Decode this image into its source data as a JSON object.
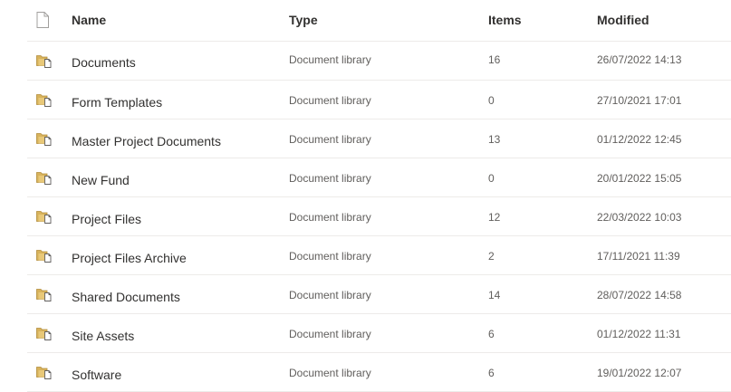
{
  "header": {
    "name": "Name",
    "type": "Type",
    "items": "Items",
    "modified": "Modified"
  },
  "rows": [
    {
      "name": "Documents",
      "type": "Document library",
      "items": "16",
      "modified": "26/07/2022 14:13"
    },
    {
      "name": "Form Templates",
      "type": "Document library",
      "items": "0",
      "modified": "27/10/2021 17:01"
    },
    {
      "name": "Master Project Documents",
      "type": "Document library",
      "items": "13",
      "modified": "01/12/2022 12:45"
    },
    {
      "name": "New Fund",
      "type": "Document library",
      "items": "0",
      "modified": "20/01/2022 15:05"
    },
    {
      "name": "Project Files",
      "type": "Document library",
      "items": "12",
      "modified": "22/03/2022 10:03"
    },
    {
      "name": "Project Files Archive",
      "type": "Document library",
      "items": "2",
      "modified": "17/11/2021 11:39"
    },
    {
      "name": "Shared Documents",
      "type": "Document library",
      "items": "14",
      "modified": "28/07/2022 14:58"
    },
    {
      "name": "Site Assets",
      "type": "Document library",
      "items": "6",
      "modified": "01/12/2022 11:31"
    },
    {
      "name": "Software",
      "type": "Document library",
      "items": "6",
      "modified": "19/01/2022 12:07"
    }
  ],
  "icons": {
    "header": "file-type-icon",
    "row": "document-library-icon"
  },
  "colors": {
    "library_icon": "#d8b35c",
    "library_icon_dark": "#b28c3a",
    "divider": "#edebe9",
    "text_primary": "#323130",
    "text_secondary": "#605e5c"
  }
}
